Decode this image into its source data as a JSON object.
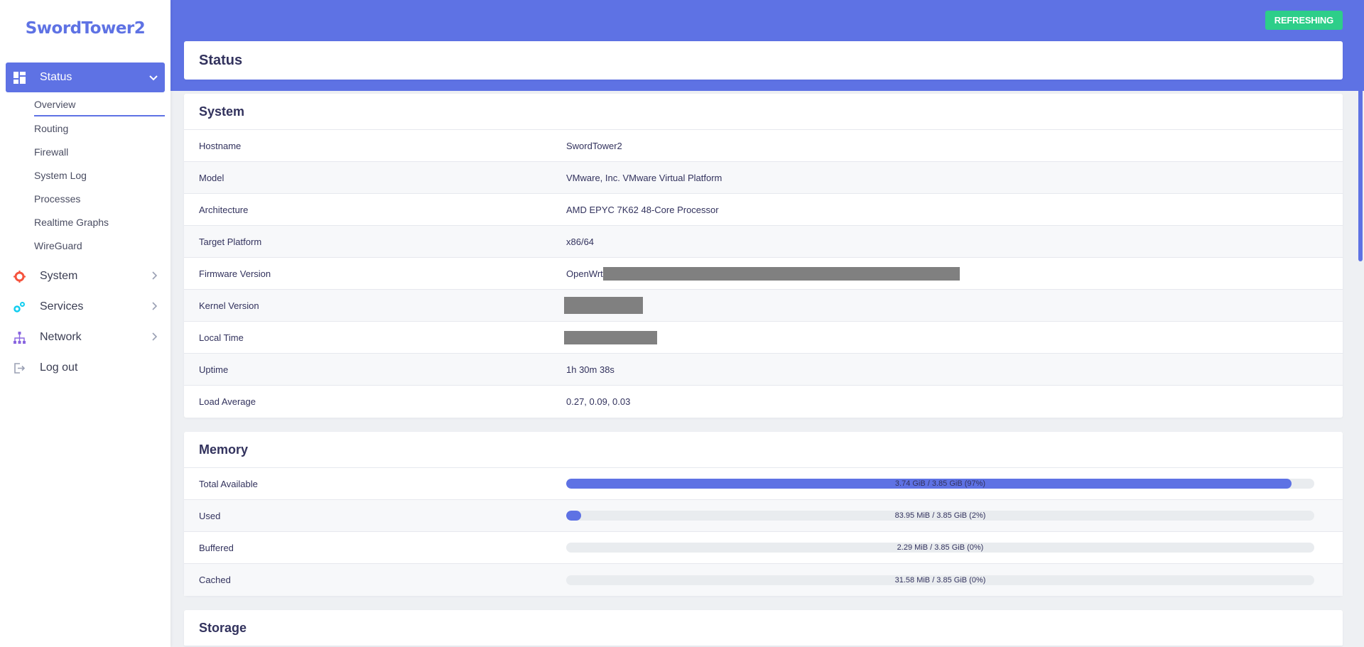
{
  "app": {
    "brand": "SwordTower2"
  },
  "header": {
    "refresh_label": "REFRESHING"
  },
  "sidebar": {
    "status": {
      "label": "Status",
      "subitems": [
        "Overview",
        "Routing",
        "Firewall",
        "System Log",
        "Processes",
        "Realtime Graphs",
        "WireGuard"
      ]
    },
    "system": {
      "label": "System"
    },
    "services": {
      "label": "Services"
    },
    "network": {
      "label": "Network"
    },
    "logout": {
      "label": "Log out"
    }
  },
  "page": {
    "title": "Status"
  },
  "system_section": {
    "title": "System",
    "rows": [
      {
        "key": "Hostname",
        "value": "SwordTower2"
      },
      {
        "key": "Model",
        "value": "VMware, Inc. VMware Virtual Platform"
      },
      {
        "key": "Architecture",
        "value": "AMD EPYC 7K62 48-Core Processor"
      },
      {
        "key": "Target Platform",
        "value": "x86/64"
      },
      {
        "key": "Firmware Version",
        "value": "OpenWrt"
      },
      {
        "key": "Kernel Version",
        "value": ""
      },
      {
        "key": "Local Time",
        "value": ""
      },
      {
        "key": "Uptime",
        "value": "1h 30m 38s"
      },
      {
        "key": "Load Average",
        "value": "0.27, 0.09, 0.03"
      }
    ]
  },
  "memory_section": {
    "title": "Memory",
    "rows": [
      {
        "key": "Total Available",
        "text": "3.74 GiB / 3.85 GiB (97%)",
        "percent": 97
      },
      {
        "key": "Used",
        "text": "83.95 MiB / 3.85 GiB (2%)",
        "percent": 2
      },
      {
        "key": "Buffered",
        "text": "2.29 MiB / 3.85 GiB (0%)",
        "percent": 0
      },
      {
        "key": "Cached",
        "text": "31.58 MiB / 3.85 GiB (0%)",
        "percent": 0
      }
    ]
  },
  "storage_section": {
    "title": "Storage"
  },
  "colors": {
    "accent": "#5e72e4",
    "refresh": "#2dce89",
    "system_icon": "#f5533d",
    "services_icon": "#11cdef",
    "network_icon": "#8965e0"
  }
}
